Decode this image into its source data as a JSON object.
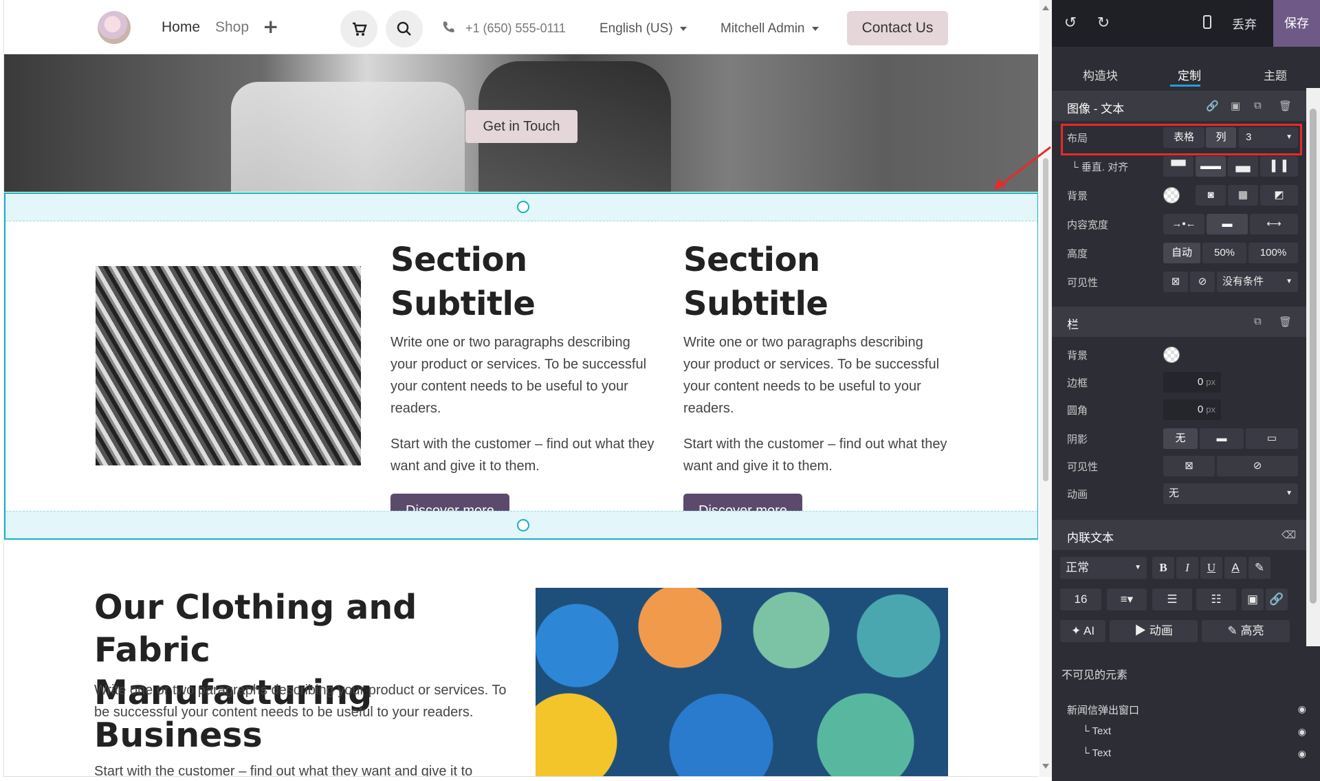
{
  "site": {
    "nav": {
      "home": "Home",
      "shop": "Shop",
      "plus": "+",
      "phone": "+1 (650) 555-0111",
      "language": "English (US)",
      "user": "Mitchell Admin",
      "contact": "Contact Us"
    },
    "hero": {
      "cta": "Get in Touch"
    },
    "columns": [
      {
        "title": "Section Subtitle",
        "p1": "Write one or two paragraphs describing your product or services. To be successful your content needs to be useful to your readers.",
        "p2": "Start with the customer – find out what they want and give it to them.",
        "button": "Discover more"
      },
      {
        "title": "Section Subtitle",
        "p1": "Write one or two paragraphs describing your product or services. To be successful your content needs to be useful to your readers.",
        "p2": "Start with the customer – find out what they want and give it to them.",
        "button": "Discover more"
      }
    ],
    "section2": {
      "title": "Our Clothing and Fabric Manufacturing Business",
      "p1": "Write one or two paragraphs describing your product or services. To be successful your content needs to be useful to your readers.",
      "p2": "Start with the customer – find out what they want and give it to"
    }
  },
  "editor": {
    "toolbar": {
      "discard": "丢弃",
      "save": "保存"
    },
    "tabs": [
      "构造块",
      "定制",
      "主题"
    ],
    "image_text": {
      "title": "图像 - 文本",
      "layout_label": "布局",
      "layout_grid": "表格",
      "layout_cols": "列",
      "layout_cols_value": "3",
      "valign_label": "└ 垂直. 对齐",
      "bg_label": "背景",
      "content_width_label": "内容宽度",
      "height_label": "高度",
      "height_auto": "自动",
      "height_50": "50%",
      "height_100": "100%",
      "visibility_label": "可见性",
      "visibility_value": "没有条件"
    },
    "column": {
      "title": "栏",
      "bg_label": "背景",
      "border_label": "边框",
      "border_value": "0",
      "radius_label": "圆角",
      "radius_value": "0",
      "unit": "px",
      "shadow_label": "阴影",
      "shadow_none": "无",
      "visibility_label": "可见性",
      "animation_label": "动画",
      "animation_value": "无"
    },
    "inline_text": {
      "title": "内联文本",
      "style": "正常",
      "bold": "B",
      "italic": "I",
      "underline": "U",
      "font_color": "A",
      "font_size": "16",
      "ai": "AI",
      "animate": "动画",
      "highlight": "高亮"
    },
    "invisible": {
      "title": "不可见的元素",
      "items": [
        "新闻信弹出窗口",
        "└ Text",
        "└ Text"
      ]
    }
  }
}
